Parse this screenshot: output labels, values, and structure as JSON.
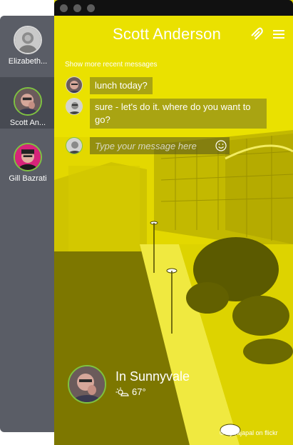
{
  "sidebar": {
    "contacts": [
      {
        "name": "Elizabeth...",
        "avatar_icon": "person-avatar",
        "status_color": "#d8d8d8"
      },
      {
        "name": "Scott An...",
        "avatar_icon": "person-avatar",
        "status_color": "#7fc241"
      },
      {
        "name": "Gill Bazrati",
        "avatar_icon": "person-avatar",
        "status_color": "#7fc241"
      }
    ]
  },
  "header": {
    "title": "Scott Anderson",
    "attach_icon": "paperclip-icon",
    "menu_icon": "hamburger-menu-icon"
  },
  "chat": {
    "show_more": "Show more recent messages",
    "messages": [
      {
        "text": "lunch today?"
      },
      {
        "text": "sure - let's do it. where do you want to go?"
      }
    ],
    "compose_placeholder": "Type your message here"
  },
  "location": {
    "city": "In Sunnyvale",
    "temperature": "67°",
    "weather_icon": "partly-sunny-icon"
  },
  "credit": "© by rajapal on flickr",
  "colors": {
    "accent": "#e6dc00",
    "online": "#7fc241",
    "sidebar": "#5a5d66"
  }
}
